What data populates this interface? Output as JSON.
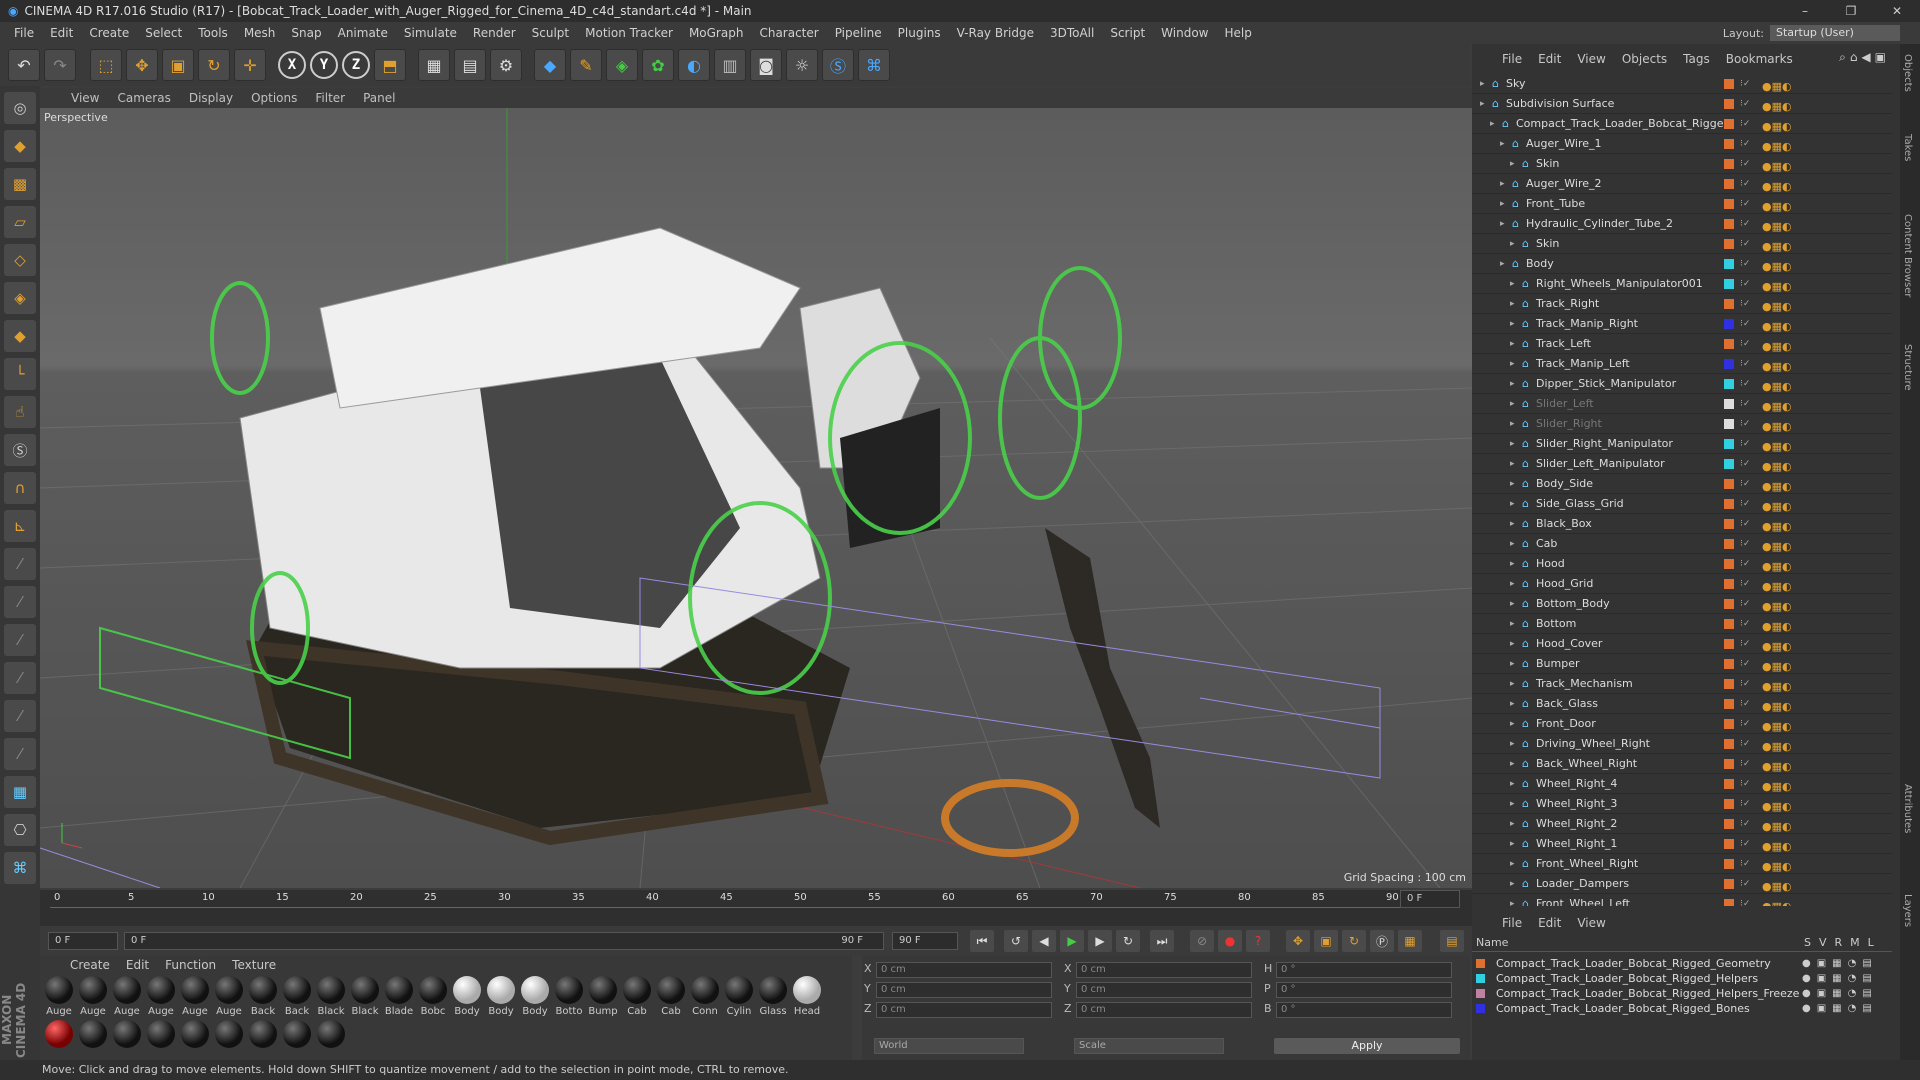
{
  "window": {
    "title": "CINEMA 4D R17.016 Studio (R17) - [Bobcat_Track_Loader_with_Auger_Rigged_for_Cinema_4D_c4d_standart.c4d *] - Main",
    "minimize": "–",
    "maximize": "❐",
    "close": "✕"
  },
  "menu": [
    "File",
    "Edit",
    "Create",
    "Select",
    "Tools",
    "Mesh",
    "Snap",
    "Animate",
    "Simulate",
    "Render",
    "Sculpt",
    "Motion Tracker",
    "MoGraph",
    "Character",
    "Pipeline",
    "Plugins",
    "V-Ray Bridge",
    "3DToAll",
    "Script",
    "Window",
    "Help"
  ],
  "layout": {
    "label": "Layout:",
    "value": "Startup (User)"
  },
  "toolbar": {
    "x": "X",
    "y": "Y",
    "z": "Z"
  },
  "viewport": {
    "menu": [
      "View",
      "Cameras",
      "Display",
      "Options",
      "Filter",
      "Panel"
    ],
    "label": "Perspective",
    "grid_spacing": "Grid Spacing : 100 cm"
  },
  "timeline": {
    "ticks": [
      "0",
      "5",
      "10",
      "15",
      "20",
      "25",
      "30",
      "35",
      "40",
      "45",
      "50",
      "55",
      "60",
      "65",
      "70",
      "75",
      "80",
      "85",
      "90"
    ],
    "current_frame": "0 F",
    "start_frame": "0 F",
    "slider_start": "0 F",
    "slider_end": "90 F",
    "end_frame": "90 F",
    "end_field": "0 F"
  },
  "materials": {
    "menu": [
      "Create",
      "Edit",
      "Function",
      "Texture"
    ],
    "row1": [
      {
        "name": "Auge",
        "tone": "d"
      },
      {
        "name": "Auge",
        "tone": "d"
      },
      {
        "name": "Auge",
        "tone": "d"
      },
      {
        "name": "Auge",
        "tone": "d"
      },
      {
        "name": "Auge",
        "tone": "d"
      },
      {
        "name": "Auge",
        "tone": "d"
      },
      {
        "name": "Back",
        "tone": "d"
      },
      {
        "name": "Back",
        "tone": "d"
      },
      {
        "name": "Black",
        "tone": "d"
      },
      {
        "name": "Black",
        "tone": "d"
      },
      {
        "name": "Blade",
        "tone": "d"
      },
      {
        "name": "Bobc",
        "tone": "d"
      },
      {
        "name": "Body",
        "tone": "w"
      },
      {
        "name": "Body",
        "tone": "w"
      },
      {
        "name": "Body",
        "tone": "w"
      },
      {
        "name": "Botto",
        "tone": "d"
      },
      {
        "name": "Bump",
        "tone": "d"
      },
      {
        "name": "Cab",
        "tone": "d"
      },
      {
        "name": "Cab",
        "tone": "d"
      },
      {
        "name": "Conn",
        "tone": "d"
      },
      {
        "name": "Cylin",
        "tone": "d"
      },
      {
        "name": "Glass",
        "tone": "d"
      },
      {
        "name": "Head",
        "tone": "w"
      }
    ],
    "row2": [
      "r",
      "d",
      "d",
      "d",
      "d",
      "d",
      "d",
      "d",
      "d"
    ]
  },
  "coords": {
    "labels": [
      "X",
      "Y",
      "Z",
      "X",
      "Y",
      "Z",
      "H",
      "P",
      "B"
    ],
    "values": [
      "0 cm",
      "0 cm",
      "0 cm",
      "0 cm",
      "0 cm",
      "0 cm",
      "0 °",
      "0 °",
      "0 °"
    ],
    "mode": "World",
    "scale": "Scale",
    "apply": "Apply"
  },
  "status": "Move: Click and drag to move elements. Hold down SHIFT to quantize movement / add to the selection in point mode, CTRL to remove.",
  "objects": {
    "menu": [
      "File",
      "Edit",
      "View",
      "Objects",
      "Tags",
      "Bookmarks"
    ],
    "rows": [
      {
        "name": "Sky",
        "level": 0,
        "color": "#e07030",
        "dim": false
      },
      {
        "name": "Subdivision Surface",
        "level": 0,
        "color": "#e07030",
        "dim": false
      },
      {
        "name": "Compact_Track_Loader_Bobcat_Rigged",
        "level": 1,
        "color": "#e07030",
        "dim": false
      },
      {
        "name": "Auger_Wire_1",
        "level": 2,
        "color": "#e07030",
        "dim": false
      },
      {
        "name": "Skin",
        "level": 3,
        "color": "#e07030",
        "dim": false
      },
      {
        "name": "Auger_Wire_2",
        "level": 2,
        "color": "#e07030",
        "dim": false
      },
      {
        "name": "Front_Tube",
        "level": 2,
        "color": "#e07030",
        "dim": false
      },
      {
        "name": "Hydraulic_Cylinder_Tube_2",
        "level": 2,
        "color": "#e07030",
        "dim": false
      },
      {
        "name": "Skin",
        "level": 3,
        "color": "#e07030",
        "dim": false
      },
      {
        "name": "Body",
        "level": 2,
        "color": "#30d0e0",
        "dim": false
      },
      {
        "name": "Right_Wheels_Manipulator001",
        "level": 3,
        "color": "#30d0e0",
        "dim": false
      },
      {
        "name": "Track_Right",
        "level": 3,
        "color": "#e07030",
        "dim": false
      },
      {
        "name": "Track_Manip_Right",
        "level": 3,
        "color": "#3030e0",
        "dim": false
      },
      {
        "name": "Track_Left",
        "level": 3,
        "color": "#e07030",
        "dim": false
      },
      {
        "name": "Track_Manip_Left",
        "level": 3,
        "color": "#3030e0",
        "dim": false
      },
      {
        "name": "Dipper_Stick_Manipulator",
        "level": 3,
        "color": "#30d0e0",
        "dim": false
      },
      {
        "name": "Slider_Left",
        "level": 3,
        "color": "#ddd",
        "dim": true
      },
      {
        "name": "Slider_Right",
        "level": 3,
        "color": "#ddd",
        "dim": true
      },
      {
        "name": "Slider_Right_Manipulator",
        "level": 3,
        "color": "#30d0e0",
        "dim": false
      },
      {
        "name": "Slider_Left_Manipulator",
        "level": 3,
        "color": "#30d0e0",
        "dim": false
      },
      {
        "name": "Body_Side",
        "level": 3,
        "color": "#e07030",
        "dim": false
      },
      {
        "name": "Side_Glass_Grid",
        "level": 3,
        "color": "#e07030",
        "dim": false
      },
      {
        "name": "Black_Box",
        "level": 3,
        "color": "#e07030",
        "dim": false
      },
      {
        "name": "Cab",
        "level": 3,
        "color": "#e07030",
        "dim": false
      },
      {
        "name": "Hood",
        "level": 3,
        "color": "#e07030",
        "dim": false
      },
      {
        "name": "Hood_Grid",
        "level": 3,
        "color": "#e07030",
        "dim": false
      },
      {
        "name": "Bottom_Body",
        "level": 3,
        "color": "#e07030",
        "dim": false
      },
      {
        "name": "Bottom",
        "level": 3,
        "color": "#e07030",
        "dim": false
      },
      {
        "name": "Hood_Cover",
        "level": 3,
        "color": "#e07030",
        "dim": false
      },
      {
        "name": "Bumper",
        "level": 3,
        "color": "#e07030",
        "dim": false
      },
      {
        "name": "Track_Mechanism",
        "level": 3,
        "color": "#e07030",
        "dim": false
      },
      {
        "name": "Back_Glass",
        "level": 3,
        "color": "#e07030",
        "dim": false
      },
      {
        "name": "Front_Door",
        "level": 3,
        "color": "#e07030",
        "dim": false
      },
      {
        "name": "Driving_Wheel_Right",
        "level": 3,
        "color": "#e07030",
        "dim": false
      },
      {
        "name": "Back_Wheel_Right",
        "level": 3,
        "color": "#e07030",
        "dim": false
      },
      {
        "name": "Wheel_Right_4",
        "level": 3,
        "color": "#e07030",
        "dim": false
      },
      {
        "name": "Wheel_Right_3",
        "level": 3,
        "color": "#e07030",
        "dim": false
      },
      {
        "name": "Wheel_Right_2",
        "level": 3,
        "color": "#e07030",
        "dim": false
      },
      {
        "name": "Wheel_Right_1",
        "level": 3,
        "color": "#e07030",
        "dim": false
      },
      {
        "name": "Front_Wheel_Right",
        "level": 3,
        "color": "#e07030",
        "dim": false
      },
      {
        "name": "Loader_Dampers",
        "level": 3,
        "color": "#e07030",
        "dim": false
      },
      {
        "name": "Front_Wheel_Left",
        "level": 3,
        "color": "#e07030",
        "dim": false
      }
    ]
  },
  "layers": {
    "menu": [
      "File",
      "Edit",
      "View"
    ],
    "header": {
      "name": "Name",
      "cols": [
        "S",
        "V",
        "R",
        "M",
        "L"
      ]
    },
    "rows": [
      {
        "name": "Compact_Track_Loader_Bobcat_Rigged_Geometry",
        "color": "#e07030"
      },
      {
        "name": "Compact_Track_Loader_Bobcat_Rigged_Helpers",
        "color": "#30d0e0"
      },
      {
        "name": "Compact_Track_Loader_Bobcat_Rigged_Helpers_Freeze",
        "color": "#c080a0"
      },
      {
        "name": "Compact_Track_Loader_Bobcat_Rigged_Bones",
        "color": "#3030e0"
      }
    ]
  },
  "sidetabs": [
    "Objects",
    "Takes",
    "Content Browser",
    "Structure",
    "Attributes",
    "Layers"
  ],
  "brand": "MAXON CINEMA 4D"
}
